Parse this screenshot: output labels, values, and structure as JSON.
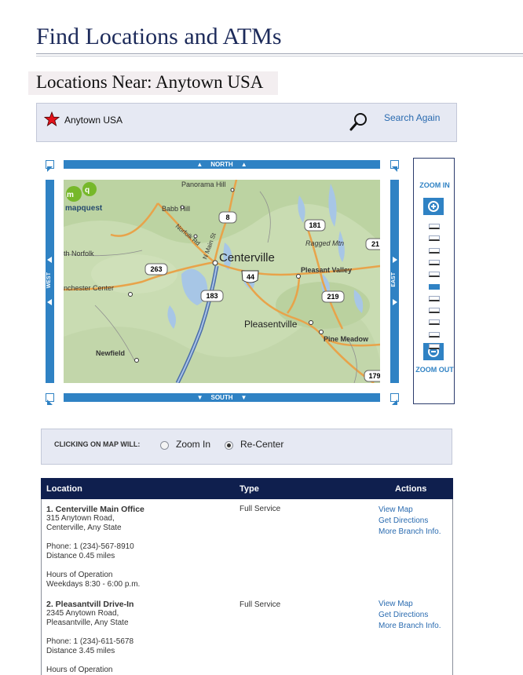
{
  "header": {
    "title": "Find Locations and ATMs",
    "subtitle": "Locations Near: Anytown USA"
  },
  "search": {
    "location": "Anytown USA",
    "again_label": "Search Again"
  },
  "map": {
    "north_label": "NORTH",
    "south_label": "SOUTH",
    "west_label": "WEST",
    "east_label": "EAST",
    "logo_text": "mapquest",
    "places": [
      "Panorama Hill",
      "Babb Hill",
      "Norfolk Rd",
      "N Main St",
      "Centerville",
      "Ragged Mtn",
      "Pleasant Valley",
      "th Norfolk",
      "nchester Center",
      "Pleasentville",
      "Pine Meadow",
      "Newfield"
    ],
    "routes": [
      "8",
      "181",
      "21",
      "263",
      "44",
      "183",
      "219",
      "179"
    ]
  },
  "zoom": {
    "in_label": "ZOOM IN",
    "out_label": "ZOOM OUT",
    "levels": 11,
    "active_level": 5
  },
  "click_options": {
    "label": "CLICKING ON MAP WILL:",
    "options": [
      "Zoom In",
      "Re-Center"
    ],
    "selected": "Re-Center"
  },
  "table": {
    "headers": [
      "Location",
      "Type",
      "Actions"
    ],
    "rows": [
      {
        "name": "1. Centerville Main Office",
        "address1": "315 Anytown Road,",
        "address2": "Centerville, Any State",
        "phone": "Phone: 1 (234)-567-8910",
        "distance": "Distance 0.45 miles",
        "hours_label": "Hours of Operation",
        "hours": "Weekdays 8:30 - 6:00 p.m.",
        "type": "Full Service",
        "actions": [
          "View Map",
          "Get Directions",
          "More Branch Info."
        ]
      },
      {
        "name": "2. Pleasantvill Drive-In",
        "address1": "2345 Anytown Road,",
        "address2": "Pleasantville, Any State",
        "phone": "Phone: 1 (234)-611-5678",
        "distance": "Distance 3.45 miles",
        "hours_label": "Hours of Operation",
        "hours": "",
        "type": "Full Service",
        "actions": [
          "View Map",
          "Get Directions",
          "More Branch Info."
        ]
      }
    ]
  },
  "colors": {
    "title": "#1c2a5a",
    "accent": "#2f82c4",
    "table_header": "#0f1f4e",
    "link": "#2a6bb0"
  }
}
